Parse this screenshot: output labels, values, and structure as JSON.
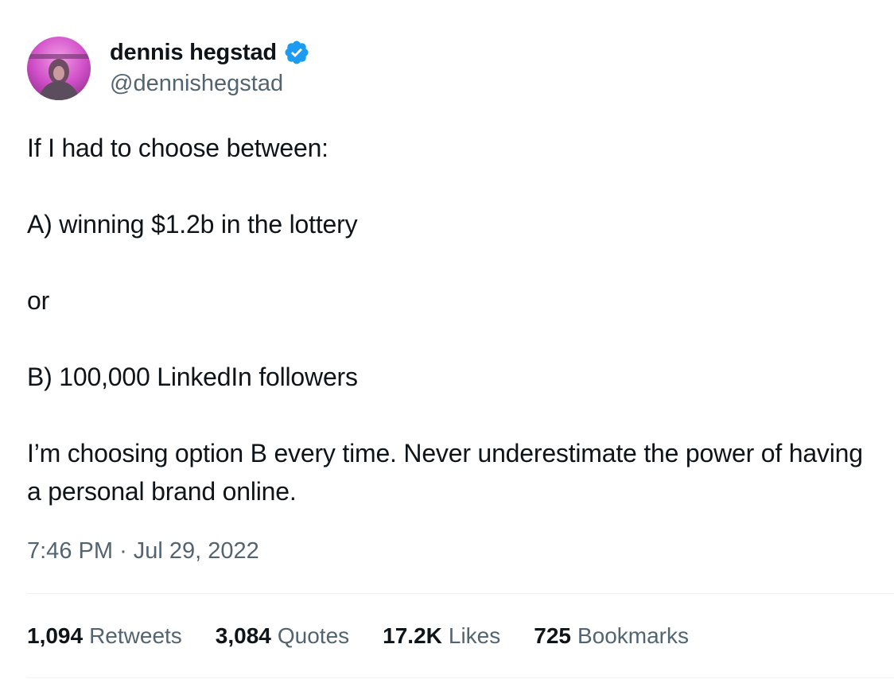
{
  "author": {
    "display_name": "dennis hegstad",
    "handle": "@dennishegstad",
    "verified_icon": "verified-badge-icon",
    "verified_color": "#1d9bf0"
  },
  "tweet": {
    "lines": [
      "If I had to choose between:",
      "",
      "A) winning $1.2b in the lottery",
      "",
      "or",
      "",
      "B) 100,000 LinkedIn followers",
      "",
      "I’m choosing option B every time. Never underestimate the power of having a personal brand online."
    ],
    "time": "7:46 PM",
    "separator": "·",
    "date": "Jul 29, 2022"
  },
  "stats": {
    "retweets": {
      "count": "1,094",
      "label": "Retweets"
    },
    "quotes": {
      "count": "3,084",
      "label": "Quotes"
    },
    "likes": {
      "count": "17.2K",
      "label": "Likes"
    },
    "bookmarks": {
      "count": "725",
      "label": "Bookmarks"
    }
  },
  "colors": {
    "text_primary": "#0f1419",
    "text_secondary": "#536471",
    "divider": "#eff3f4",
    "avatar_bg": "#d65ad0"
  }
}
